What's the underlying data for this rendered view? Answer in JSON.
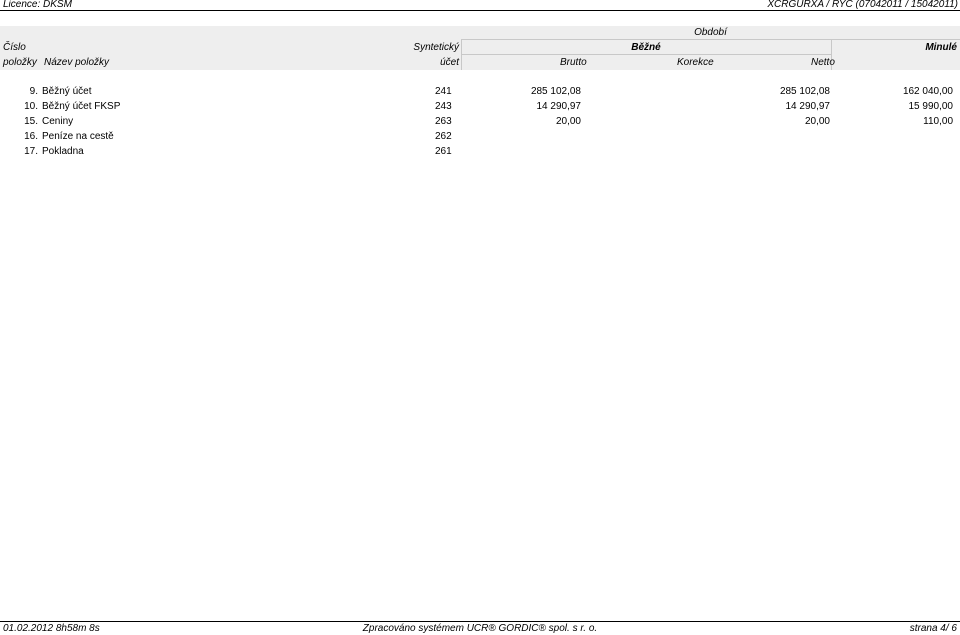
{
  "top": {
    "licence": "Licence: DKSM",
    "report_id": "XCRGURXA / RYC  (07042011 / 15042011)"
  },
  "header": {
    "obdobi": "Období",
    "cislo": "Číslo",
    "polozky": "položky",
    "nazev_polozky": "Název položky",
    "synteticky": "Syntetický",
    "ucet": "účet",
    "bezne": "Běžné",
    "minule": "Minulé",
    "brutto": "Brutto",
    "korekce": "Korekce",
    "netto": "Netto"
  },
  "rows": [
    {
      "num": "9.",
      "name": "Běžný účet",
      "account": "241",
      "brutto": "285 102,08",
      "korekce": "",
      "netto": "285 102,08",
      "previous": "162 040,00"
    },
    {
      "num": "10.",
      "name": "Běžný účet FKSP",
      "account": "243",
      "brutto": "14 290,97",
      "korekce": "",
      "netto": "14 290,97",
      "previous": "15 990,00"
    },
    {
      "num": "15.",
      "name": "Ceniny",
      "account": "263",
      "brutto": "20,00",
      "korekce": "",
      "netto": "20,00",
      "previous": "110,00"
    },
    {
      "num": "16.",
      "name": "Peníze na cestě",
      "account": "262",
      "brutto": "",
      "korekce": "",
      "netto": "",
      "previous": ""
    },
    {
      "num": "17.",
      "name": "Pokladna",
      "account": "261",
      "brutto": "",
      "korekce": "",
      "netto": "",
      "previous": ""
    }
  ],
  "footer": {
    "timestamp": "01.02.2012 8h58m 8s",
    "processed_by": "Zpracováno systémem  UCR® GORDIC® spol. s  r. o.",
    "page": "strana 4/ 6"
  }
}
